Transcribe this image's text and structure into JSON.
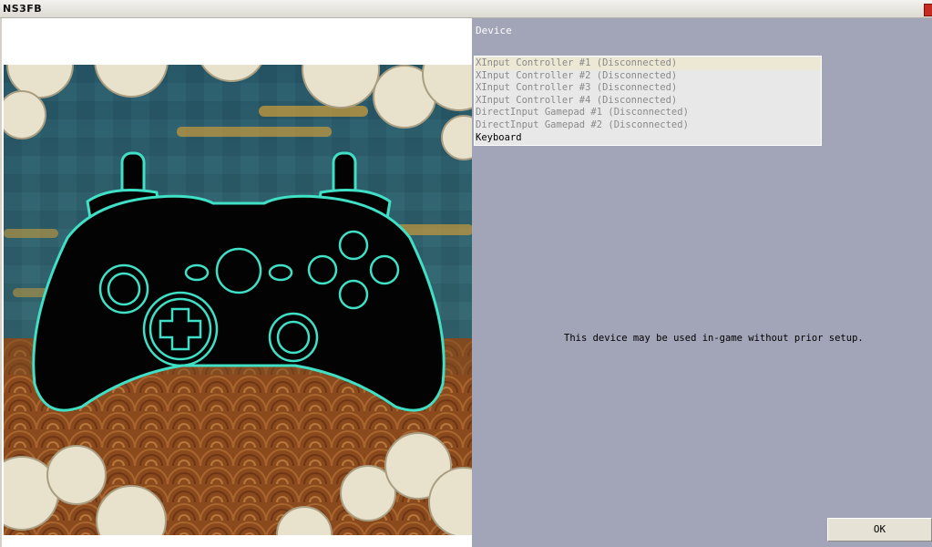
{
  "window": {
    "title": "NS3FB"
  },
  "controller_art": {
    "icon": "gamepad-icon",
    "outline_color": "#3fe0c5",
    "body_color": "#030303"
  },
  "device_panel": {
    "label": "Device",
    "devices": [
      {
        "label": "XInput Controller #1 (Disconnected)",
        "state": "disabled"
      },
      {
        "label": "XInput Controller #2 (Disconnected)",
        "state": "disabled"
      },
      {
        "label": "XInput Controller #3 (Disconnected)",
        "state": "disabled"
      },
      {
        "label": "XInput Controller #4 (Disconnected)",
        "state": "disabled"
      },
      {
        "label": "DirectInput Gamepad #1 (Disconnected)",
        "state": "disabled"
      },
      {
        "label": "DirectInput Gamepad #2 (Disconnected)",
        "state": "disabled"
      },
      {
        "label": "Keyboard",
        "state": "enabled"
      }
    ],
    "info_message": "This device may be used in-game without prior setup."
  },
  "ok_button": {
    "label": "OK"
  }
}
